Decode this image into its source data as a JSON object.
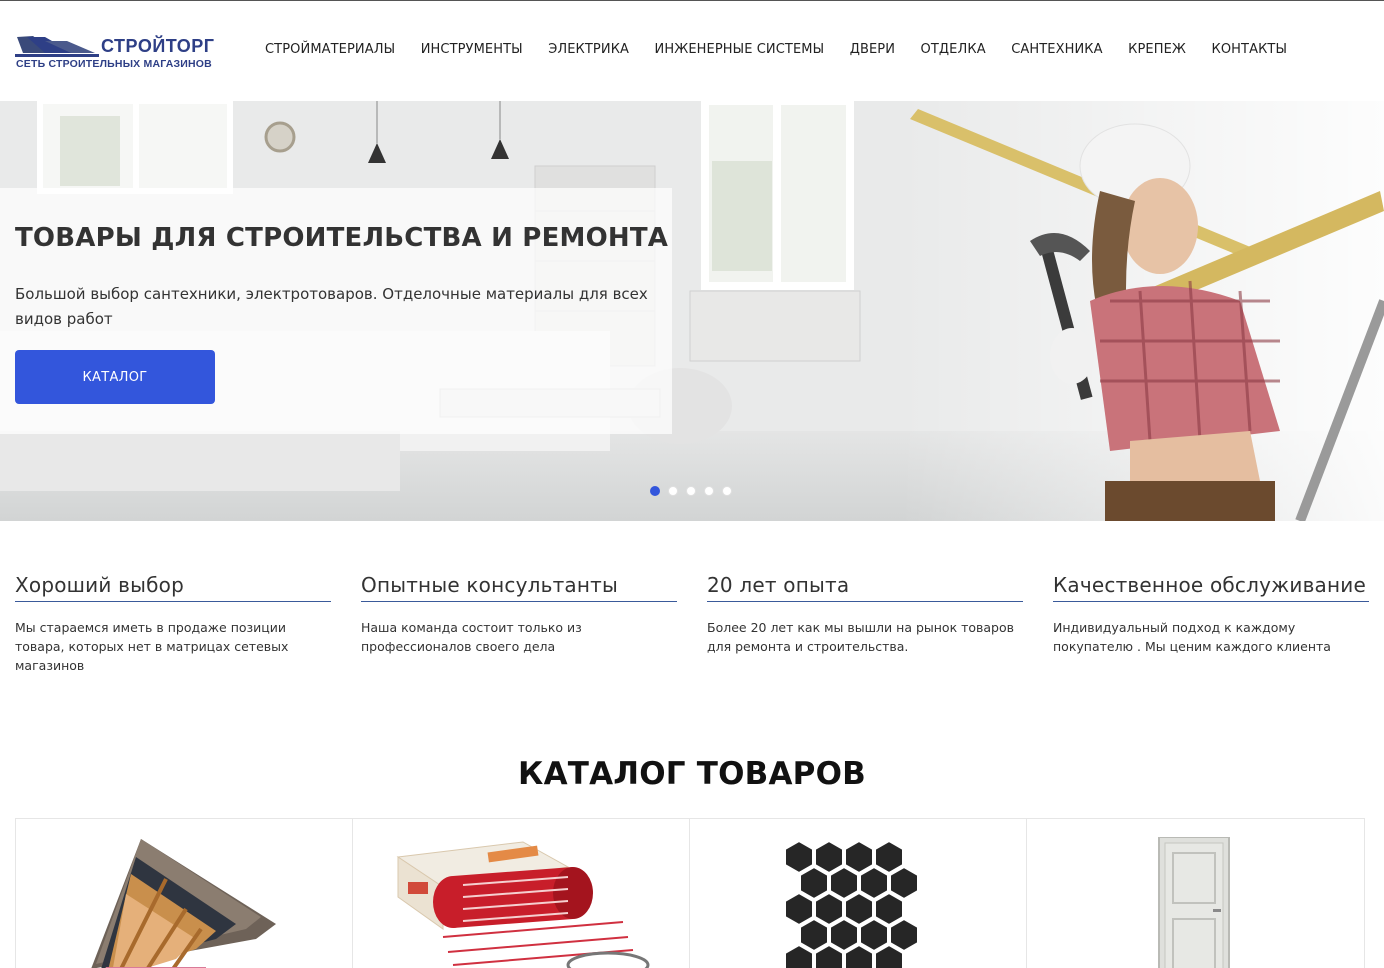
{
  "header": {
    "logo": {
      "title": "СТРОЙТОРГ",
      "subtitle": "СЕТЬ СТРОИТЕЛЬНЫХ МАГАЗИНОВ"
    },
    "nav": [
      {
        "label": "СТРОЙМАТЕРИАЛЫ"
      },
      {
        "label": "ИНСТРУМЕНТЫ"
      },
      {
        "label": "ЭЛЕКТРИКА"
      },
      {
        "label": "ИНЖЕНЕРНЫЕ СИСТЕМЫ"
      },
      {
        "label": "ДВЕРИ"
      },
      {
        "label": "ОТДЕЛКА"
      },
      {
        "label": "САНТЕХНИКА"
      },
      {
        "label": "КРЕПЕЖ"
      },
      {
        "label": "КОНТАКТЫ"
      }
    ]
  },
  "hero": {
    "title": "ТОВАРЫ ДЛЯ СТРОИТЕЛЬСТВА И РЕМОНТА",
    "text": "Большой выбор сантехники, электротоваров. Отделочные материалы для всех видов работ",
    "button_label": "КАТАЛОГ",
    "slides_total": 5,
    "active_slide": 1
  },
  "features": [
    {
      "title": "Хороший выбор",
      "text": "Мы стараемся иметь в продаже позиции товара, которых нет в матрицах сетевых магазинов"
    },
    {
      "title": "Опытные консультанты",
      "text": "Наша команда состоит только из профессионалов своего дела"
    },
    {
      "title": "20 лет опыта",
      "text": "Более 20 лет как мы вышли на рынок товаров для ремонта и строительства."
    },
    {
      "title": "Качественное обслуживание",
      "text": "Индивидуальный подход к каждому покупателю . Мы ценим каждого клиента"
    }
  ],
  "catalog": {
    "title": "КАТАЛОГ ТОВАРОВ",
    "items": [
      {
        "image": "roof-layers-image"
      },
      {
        "image": "heating-mat-image"
      },
      {
        "image": "hexagon-tile-image"
      },
      {
        "image": "door-image"
      }
    ]
  },
  "colors": {
    "brand": "#2e3f86",
    "accent": "#3356dc",
    "text": "#333333"
  }
}
